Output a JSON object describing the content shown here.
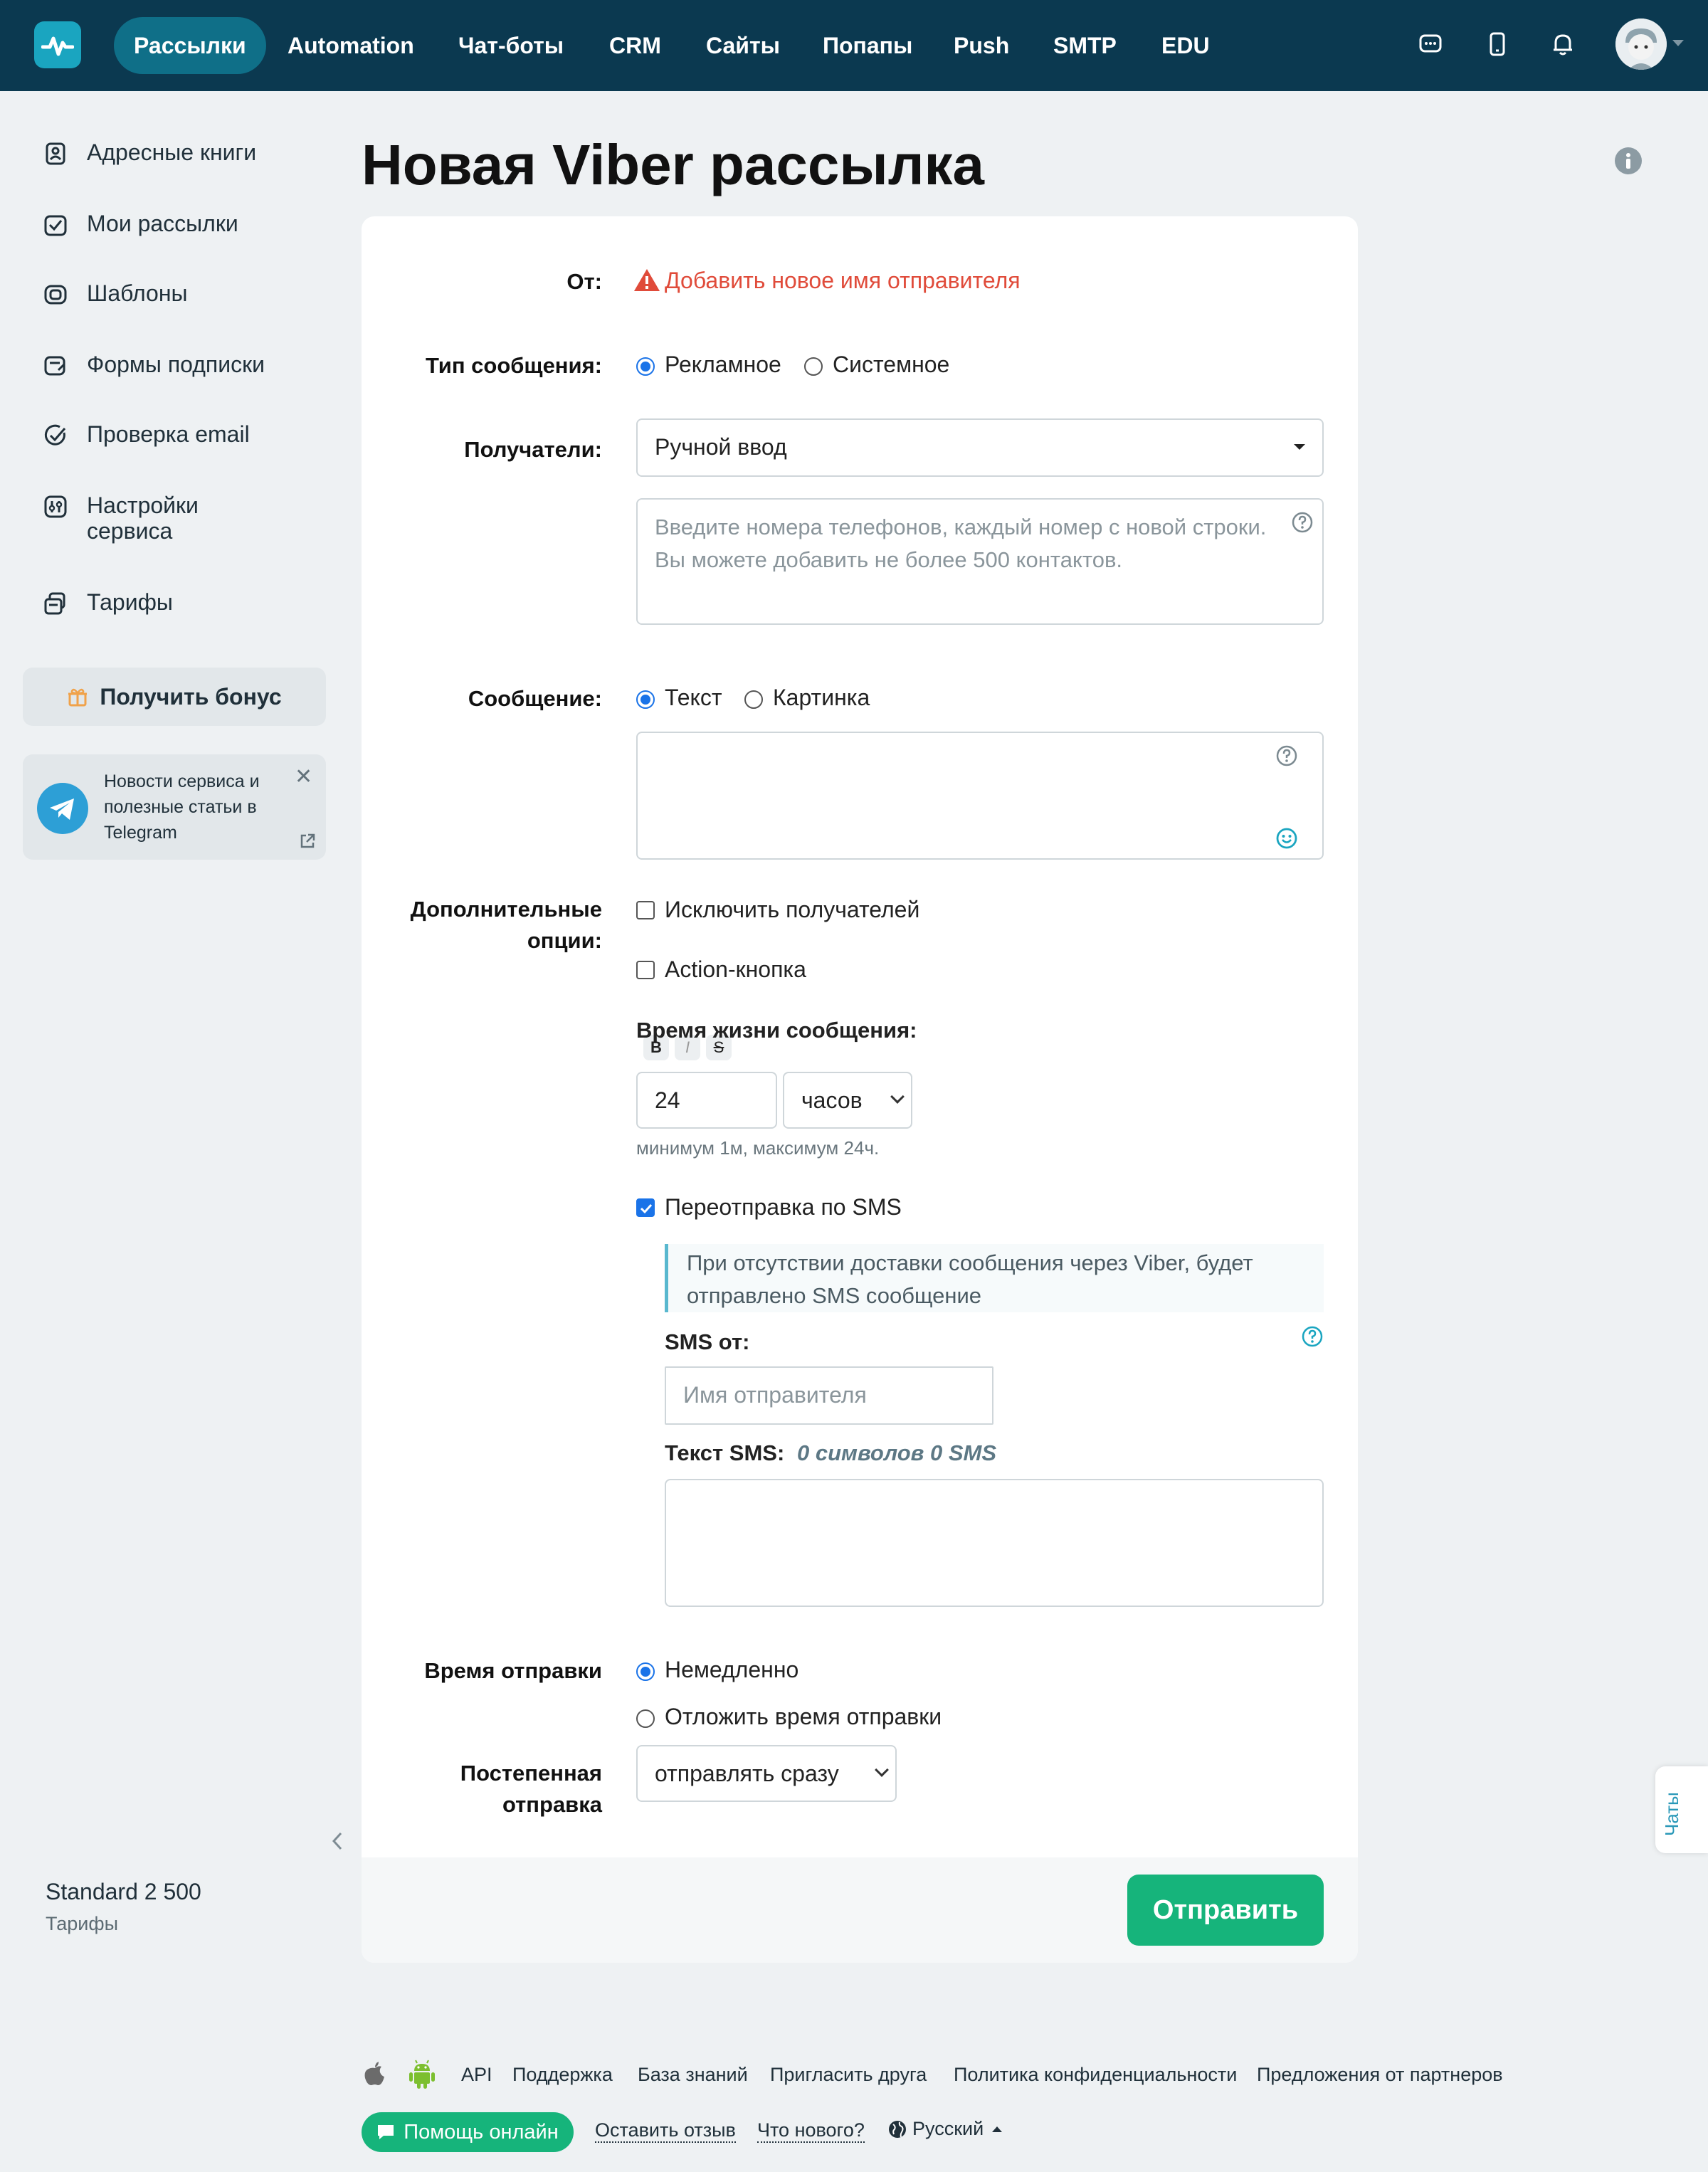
{
  "nav": {
    "items": [
      "Рассылки",
      "Automation",
      "Чат-боты",
      "CRM",
      "Сайты",
      "Попапы",
      "Push",
      "SMTP",
      "EDU"
    ],
    "active_index": 0
  },
  "sidebar": {
    "items": [
      {
        "label": "Адресные книги",
        "icon": "address-book-icon"
      },
      {
        "label": "Мои рассылки",
        "icon": "mailings-icon"
      },
      {
        "label": "Шаблоны",
        "icon": "templates-icon"
      },
      {
        "label": "Формы подписки",
        "icon": "forms-icon"
      },
      {
        "label": "Проверка email",
        "icon": "check-email-icon"
      },
      {
        "label": "Настройки сервиса",
        "icon": "settings-icon"
      },
      {
        "label": "Тарифы",
        "icon": "tariffs-icon"
      }
    ],
    "bonus_label": "Получить бонус",
    "telegram_text": "Новости сервиса и полезные статьи в Telegram",
    "plan_name": "Standard 2 500",
    "plan_link": "Тарифы"
  },
  "page": {
    "title": "Новая Viber рассылка"
  },
  "form": {
    "from_label": "От:",
    "from_warning": "Добавить новое имя отправителя",
    "msg_type_label": "Тип сообщения:",
    "msg_type_options": [
      "Рекламное",
      "Системное"
    ],
    "recipients_label": "Получатели:",
    "recipients_select": "Ручной ввод",
    "phones_placeholder": "Введите номера телефонов, каждый номер с новой строки. Вы можете добавить не более 500 контактов.",
    "message_label": "Сообщение:",
    "message_options": [
      "Текст",
      "Картинка"
    ],
    "format_buttons": [
      "B",
      "I",
      "S"
    ],
    "extra_label": "Дополнительные опции:",
    "exclude_label": "Исключить получателей",
    "action_button_label": "Action-кнопка",
    "lifetime_label": "Время жизни сообщения:",
    "lifetime_value": "24",
    "lifetime_unit": "часов",
    "lifetime_hint": "минимум 1м, максимум 24ч.",
    "sms_resend_label": "Переотправка по SMS",
    "sms_resend_checked": true,
    "sms_note": "При отсутствии доставки сообщения через Viber, будет отправлено SMS сообщение",
    "sms_from_label": "SMS от:",
    "sms_from_placeholder": "Имя отправителя",
    "sms_text_label": "Текст SMS:",
    "sms_counter": "0 символов 0 SMS",
    "send_time_label": "Время отправки",
    "send_time_options": [
      "Немедленно",
      "Отложить время отправки"
    ],
    "gradual_label": "Постепенная отправка",
    "gradual_value": "отправлять сразу",
    "submit_label": "Отправить"
  },
  "chats_tab": "Чаты",
  "footer": {
    "links": [
      "API",
      "Поддержка",
      "База знаний",
      "Пригласить друга",
      "Политика конфиденциальности",
      "Предложения от партнеров"
    ],
    "help_button": "Помощь онлайн",
    "feedback": "Оставить отзыв",
    "whats_new": "Что нового?",
    "language": "Русский"
  },
  "colors": {
    "topbar": "#0b3950",
    "nav_active": "#0f6f88",
    "accent_green": "#16b47b",
    "warning_red": "#e04b3a",
    "link_teal": "#2a98b8"
  }
}
